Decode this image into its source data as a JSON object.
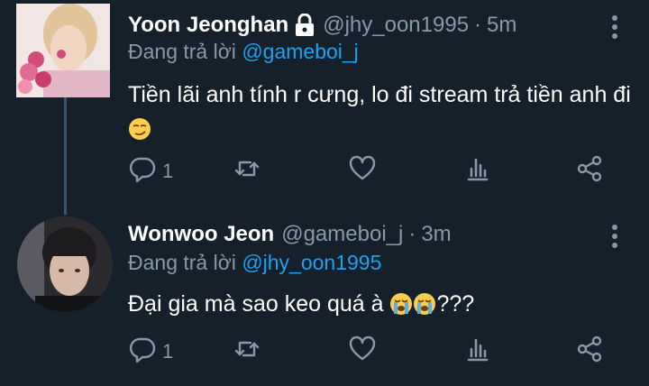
{
  "tweets": [
    {
      "name": "Yoon Jeonghan",
      "handle": "@jhy_oon1995",
      "separator": "·",
      "time": "5m",
      "reply_prefix": "Đang trả lời",
      "reply_to": "@gameboi_j",
      "text": "Tiền lãi anh tính r cưng, lo đi stream trả tiền anh đi",
      "emoji": "smirk-emoji",
      "reply_count": "1",
      "protected": true
    },
    {
      "name": "Wonwoo Jeon",
      "handle": "@gameboi_j",
      "separator": "·",
      "time": "3m",
      "reply_prefix": "Đang trả lời",
      "reply_to": "@jhy_oon1995",
      "text": "Đại gia mà sao keo quá à",
      "text_suffix": "???",
      "emoji": "crying-emoji",
      "reply_count": "1"
    }
  ],
  "icons": {
    "reply": "reply-icon",
    "retweet": "retweet-icon",
    "like": "heart-icon",
    "stats": "analytics-icon",
    "share": "share-icon",
    "more": "more-vertical-icon",
    "lock": "lock-icon"
  },
  "colors": {
    "background": "#15202b",
    "secondary_text": "#8899a6",
    "link": "#1da1f2",
    "thread_line": "#3d5466"
  }
}
